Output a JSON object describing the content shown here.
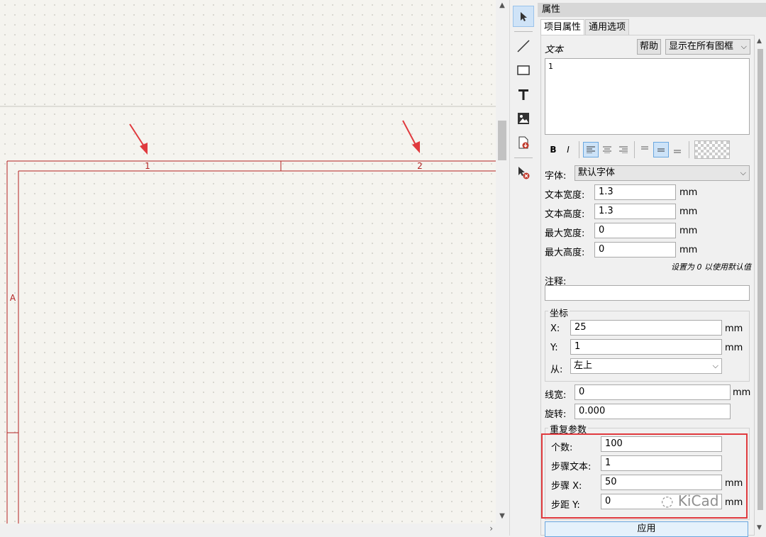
{
  "canvas": {
    "col_labels": [
      "1",
      "2"
    ],
    "row_labels": [
      "A"
    ]
  },
  "panel": {
    "title": "属性",
    "tabs": [
      {
        "label": "项目属性",
        "active": true
      },
      {
        "label": "通用选项",
        "active": false
      }
    ],
    "text_label": "文本",
    "help_button": "帮助",
    "frame_select": "显示在所有图框",
    "text_value": "1",
    "format": {
      "bold": "B",
      "italic": "I"
    },
    "font_label": "字体:",
    "font_value": "默认字体",
    "rows": [
      {
        "label": "文本宽度:",
        "value": "1.3",
        "unit": "mm"
      },
      {
        "label": "文本高度:",
        "value": "1.3",
        "unit": "mm"
      },
      {
        "label": "最大宽度:",
        "value": "0",
        "unit": "mm"
      },
      {
        "label": "最大高度:",
        "value": "0",
        "unit": "mm"
      }
    ],
    "hint": "设置为 0 以使用默认值",
    "comment_label": "注释:",
    "comment_value": "",
    "coords": {
      "title": "坐标",
      "x_label": "X:",
      "x_value": "25",
      "x_unit": "mm",
      "y_label": "Y:",
      "y_value": "1",
      "y_unit": "mm",
      "from_label": "从:",
      "from_value": "左上"
    },
    "line_width_label": "线宽:",
    "line_width_value": "0",
    "line_width_unit": "mm",
    "rotation_label": "旋转:",
    "rotation_value": "0.000",
    "repeat": {
      "title": "重复参数",
      "count_label": "个数:",
      "count_value": "100",
      "step_text_label": "步骤文本:",
      "step_text_value": "1",
      "step_x_label": "步骤 X:",
      "step_x_value": "50",
      "step_x_unit": "mm",
      "step_y_label": "步距 Y:",
      "step_y_value": "0",
      "step_y_unit": "mm"
    },
    "apply_button": "应用"
  },
  "watermark": "KiCad",
  "colors": {
    "frame": "#b22222",
    "arrow": "#e03a3e",
    "highlight_box": "#e03a3e"
  }
}
